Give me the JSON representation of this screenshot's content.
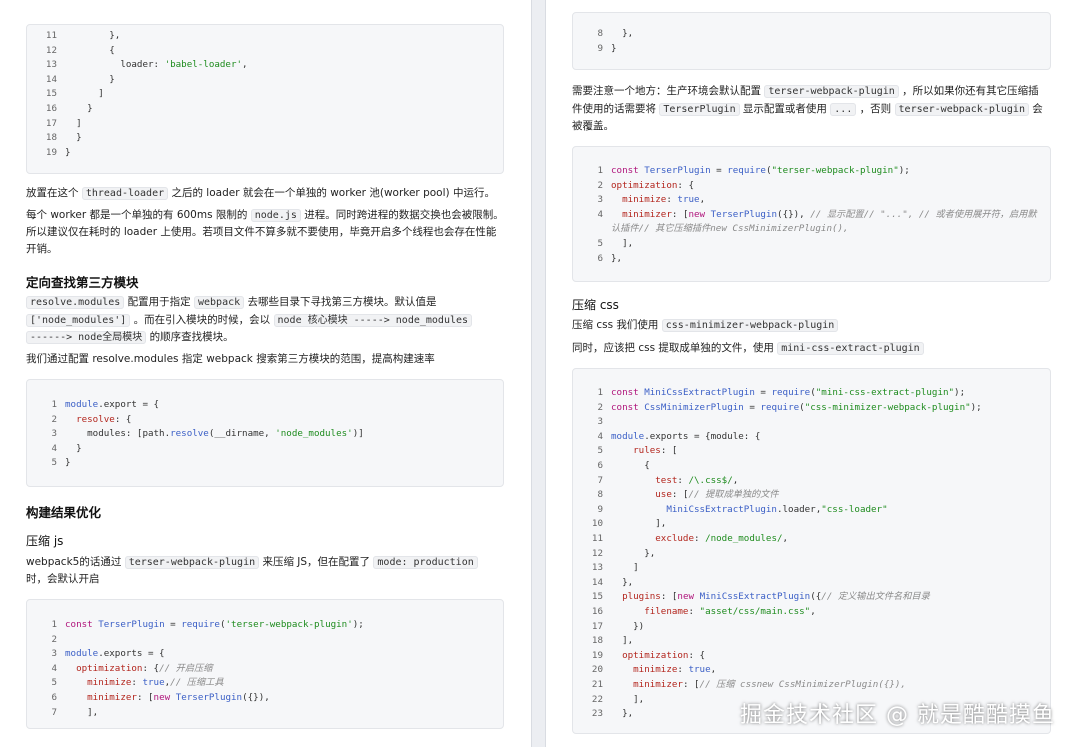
{
  "left": {
    "code1": [
      {
        "n": "11",
        "t": [
          [
            "p",
            "        },"
          ]
        ]
      },
      {
        "n": "12",
        "t": [
          [
            "p",
            "        {"
          ]
        ]
      },
      {
        "n": "13",
        "t": [
          [
            "p",
            "          loader: "
          ],
          [
            "s",
            "'babel-loader'"
          ],
          [
            "p",
            ","
          ]
        ]
      },
      {
        "n": "14",
        "t": [
          [
            "p",
            "        }"
          ]
        ]
      },
      {
        "n": "15",
        "t": [
          [
            "p",
            "      ]"
          ]
        ]
      },
      {
        "n": "16",
        "t": [
          [
            "p",
            "    }"
          ]
        ]
      },
      {
        "n": "17",
        "t": [
          [
            "p",
            "  ]"
          ]
        ]
      },
      {
        "n": "18",
        "t": [
          [
            "p",
            "  }"
          ]
        ]
      },
      {
        "n": "19",
        "t": [
          [
            "p",
            "}"
          ]
        ]
      }
    ],
    "para1": [
      [
        "t",
        "放置在这个 "
      ],
      [
        "code",
        "thread-loader"
      ],
      [
        "t",
        " 之后的 loader 就会在一个单独的 worker 池(worker pool) 中运行。"
      ]
    ],
    "para2_l1": [
      [
        "t",
        "每个 worker 都是一个单独的有 600ms 限制的 "
      ],
      [
        "code",
        "node.js"
      ],
      [
        "t",
        " 进程。同时跨进程的数据交换也会被限制。"
      ]
    ],
    "para2_l2": [
      [
        "t",
        "所以建议仅在耗时的 loader 上使用。若项目文件不算多就不要使用，毕竟开启多个线程也会存在性能"
      ]
    ],
    "para2_l3": [
      [
        "t",
        "开销。"
      ]
    ],
    "heading_resolve": "定向查找第三方模块",
    "para3_l1": [
      [
        "code",
        "resolve.modules"
      ],
      [
        "t",
        " 配置用于指定 "
      ],
      [
        "code",
        "webpack"
      ],
      [
        "t",
        " 去哪些目录下寻找第三方模块。默认值是"
      ]
    ],
    "para3_l2": [
      [
        "code",
        "['node_modules']"
      ],
      [
        "t",
        " 。而在引入模块的时候，会以 "
      ],
      [
        "code",
        "node 核心模块 -----> node_modules"
      ]
    ],
    "para3_l3": [
      [
        "code",
        "------> node全局模块"
      ],
      [
        "t",
        " 的顺序查找模块。"
      ]
    ],
    "para4": [
      [
        "t",
        "我们通过配置 resolve.modules 指定 webpack 搜索第三方模块的范围，提高构建速率"
      ]
    ],
    "code2": [
      {
        "n": "1",
        "t": [
          [
            "f",
            "module"
          ],
          [
            "p",
            ".export = {"
          ]
        ]
      },
      {
        "n": "2",
        "t": [
          [
            "p",
            "  "
          ],
          [
            "r",
            "resolve"
          ],
          [
            "p",
            ": {"
          ]
        ]
      },
      {
        "n": "3",
        "t": [
          [
            "p",
            "    modules: [path."
          ],
          [
            "f",
            "resolve"
          ],
          [
            "p",
            "(__dirname, "
          ],
          [
            "s",
            "'node_modules'"
          ],
          [
            "p",
            ")]"
          ]
        ]
      },
      {
        "n": "4",
        "t": [
          [
            "p",
            "  }"
          ]
        ]
      },
      {
        "n": "5",
        "t": [
          [
            "p",
            "}"
          ]
        ]
      }
    ],
    "heading_build": "构建结果优化",
    "heading_js": "压缩 js",
    "para5_l1": [
      [
        "t",
        "webpack5的话通过 "
      ],
      [
        "code",
        "terser-webpack-plugin"
      ],
      [
        "t",
        " 来压缩 JS，但在配置了 "
      ],
      [
        "code",
        "mode: production"
      ]
    ],
    "para5_l2": [
      [
        "t",
        "时，会默认开启"
      ]
    ],
    "code3": [
      {
        "n": "1",
        "t": [
          [
            "k",
            "const"
          ],
          [
            "p",
            " "
          ],
          [
            "f",
            "TerserPlugin"
          ],
          [
            "p",
            " = "
          ],
          [
            "f",
            "require"
          ],
          [
            "p",
            "("
          ],
          [
            "s",
            "'terser-webpack-plugin'"
          ],
          [
            "p",
            ");"
          ]
        ]
      },
      {
        "n": "2",
        "t": [
          [
            "p",
            ""
          ]
        ]
      },
      {
        "n": "3",
        "t": [
          [
            "f",
            "module"
          ],
          [
            "p",
            ".exports = {"
          ]
        ]
      },
      {
        "n": "4",
        "t": [
          [
            "p",
            "  "
          ],
          [
            "r",
            "optimization"
          ],
          [
            "p",
            ": {"
          ],
          [
            "c",
            "// 开启压缩"
          ]
        ]
      },
      {
        "n": "5",
        "t": [
          [
            "p",
            "    "
          ],
          [
            "r",
            "minimize"
          ],
          [
            "p",
            ": "
          ],
          [
            "f",
            "true"
          ],
          [
            "p",
            ","
          ],
          [
            "c",
            "// 压缩工具"
          ]
        ]
      },
      {
        "n": "6",
        "t": [
          [
            "p",
            "    "
          ],
          [
            "r",
            "minimizer"
          ],
          [
            "p",
            ": ["
          ],
          [
            "k",
            "new"
          ],
          [
            "p",
            " "
          ],
          [
            "f",
            "TerserPlugin"
          ],
          [
            "p",
            "({}),"
          ]
        ]
      },
      {
        "n": "7",
        "t": [
          [
            "p",
            "    ],"
          ]
        ]
      }
    ]
  },
  "right": {
    "code1": [
      {
        "n": "8",
        "t": [
          [
            "p",
            "  },"
          ]
        ]
      },
      {
        "n": "9",
        "t": [
          [
            "p",
            "}"
          ]
        ]
      }
    ],
    "para1_l1": [
      [
        "t",
        "需要注意一个地方：生产环境会默认配置 "
      ],
      [
        "code",
        "terser-webpack-plugin"
      ],
      [
        "t",
        " ，所以如果你还有其它压缩插"
      ]
    ],
    "para1_l2": [
      [
        "t",
        "件使用的话需要将 "
      ],
      [
        "code",
        "TerserPlugin"
      ],
      [
        "t",
        " 显示配置或者使用 "
      ],
      [
        "code",
        "..."
      ],
      [
        "t",
        " ，否则 "
      ],
      [
        "code",
        "terser-webpack-plugin"
      ],
      [
        "t",
        " 会"
      ]
    ],
    "para1_l3": [
      [
        "t",
        "被覆盖。"
      ]
    ],
    "code2": [
      {
        "n": "1",
        "t": [
          [
            "k",
            "const"
          ],
          [
            "p",
            " "
          ],
          [
            "f",
            "TerserPlugin"
          ],
          [
            "p",
            " = "
          ],
          [
            "f",
            "require"
          ],
          [
            "p",
            "("
          ],
          [
            "s",
            "\"terser-webpack-plugin\""
          ],
          [
            "p",
            ");"
          ]
        ]
      },
      {
        "n": "2",
        "t": [
          [
            "r",
            "optimization"
          ],
          [
            "p",
            ": {"
          ]
        ]
      },
      {
        "n": "3",
        "t": [
          [
            "p",
            "  "
          ],
          [
            "r",
            "minimize"
          ],
          [
            "p",
            ": "
          ],
          [
            "f",
            "true"
          ],
          [
            "p",
            ","
          ]
        ]
      },
      {
        "n": "4",
        "t": [
          [
            "p",
            "  "
          ],
          [
            "r",
            "minimizer"
          ],
          [
            "p",
            ": ["
          ],
          [
            "k",
            "new"
          ],
          [
            "p",
            " "
          ],
          [
            "f",
            "TerserPlugin"
          ],
          [
            "p",
            "({}), "
          ],
          [
            "c",
            "// 显示配置// \"...\", // 或者使用展开符，启用默"
          ]
        ]
      },
      {
        "n": "",
        "t": [
          [
            "c",
            "认插件// 其它压缩插件new CssMinimizerPlugin(),"
          ]
        ]
      },
      {
        "n": "5",
        "t": [
          [
            "p",
            "  ],"
          ]
        ]
      },
      {
        "n": "6",
        "t": [
          [
            "p",
            "},"
          ]
        ]
      }
    ],
    "heading_css": "压缩 css",
    "para2": [
      [
        "t",
        "压缩 css 我们使用 "
      ],
      [
        "code",
        "css-minimizer-webpack-plugin"
      ]
    ],
    "para3": [
      [
        "t",
        "同时，应该把 css 提取成单独的文件，使用 "
      ],
      [
        "code",
        "mini-css-extract-plugin"
      ]
    ],
    "code3": [
      {
        "n": "1",
        "t": [
          [
            "k",
            "const"
          ],
          [
            "p",
            " "
          ],
          [
            "f",
            "MiniCssExtractPlugin"
          ],
          [
            "p",
            " = "
          ],
          [
            "f",
            "require"
          ],
          [
            "p",
            "("
          ],
          [
            "s",
            "\"mini-css-extract-plugin\""
          ],
          [
            "p",
            ");"
          ]
        ]
      },
      {
        "n": "2",
        "t": [
          [
            "k",
            "const"
          ],
          [
            "p",
            " "
          ],
          [
            "f",
            "CssMinimizerPlugin"
          ],
          [
            "p",
            " = "
          ],
          [
            "f",
            "require"
          ],
          [
            "p",
            "("
          ],
          [
            "s",
            "\"css-minimizer-webpack-plugin\""
          ],
          [
            "p",
            ");"
          ]
        ]
      },
      {
        "n": "3",
        "t": [
          [
            "p",
            ""
          ]
        ]
      },
      {
        "n": "4",
        "t": [
          [
            "f",
            "module"
          ],
          [
            "p",
            ".exports = {module: {"
          ]
        ]
      },
      {
        "n": "5",
        "t": [
          [
            "p",
            "    "
          ],
          [
            "r",
            "rules"
          ],
          [
            "p",
            ": ["
          ]
        ]
      },
      {
        "n": "6",
        "t": [
          [
            "p",
            "      {"
          ]
        ]
      },
      {
        "n": "7",
        "t": [
          [
            "p",
            "        "
          ],
          [
            "r",
            "test"
          ],
          [
            "p",
            ": "
          ],
          [
            "s",
            "/\\.css$/"
          ],
          [
            "p",
            ","
          ]
        ]
      },
      {
        "n": "8",
        "t": [
          [
            "p",
            "        "
          ],
          [
            "r",
            "use"
          ],
          [
            "p",
            ": ["
          ],
          [
            "c",
            "// 提取成单独的文件"
          ]
        ]
      },
      {
        "n": "9",
        "t": [
          [
            "p",
            "          "
          ],
          [
            "f",
            "MiniCssExtractPlugin"
          ],
          [
            "p",
            ".loader,"
          ],
          [
            "s",
            "\"css-loader\""
          ]
        ]
      },
      {
        "n": "10",
        "t": [
          [
            "p",
            "        ],"
          ]
        ]
      },
      {
        "n": "11",
        "t": [
          [
            "p",
            "        "
          ],
          [
            "r",
            "exclude"
          ],
          [
            "p",
            ": "
          ],
          [
            "s",
            "/node_modules/"
          ],
          [
            "p",
            ","
          ]
        ]
      },
      {
        "n": "12",
        "t": [
          [
            "p",
            "      },"
          ]
        ]
      },
      {
        "n": "13",
        "t": [
          [
            "p",
            "    ]"
          ]
        ]
      },
      {
        "n": "14",
        "t": [
          [
            "p",
            "  },"
          ]
        ]
      },
      {
        "n": "15",
        "t": [
          [
            "p",
            "  "
          ],
          [
            "r",
            "plugins"
          ],
          [
            "p",
            ": ["
          ],
          [
            "k",
            "new"
          ],
          [
            "p",
            " "
          ],
          [
            "f",
            "MiniCssExtractPlugin"
          ],
          [
            "p",
            "({"
          ],
          [
            "c",
            "// 定义输出文件名和目录"
          ]
        ]
      },
      {
        "n": "16",
        "t": [
          [
            "p",
            "      "
          ],
          [
            "r",
            "filename"
          ],
          [
            "p",
            ": "
          ],
          [
            "s",
            "\"asset/css/main.css\""
          ],
          [
            "p",
            ","
          ]
        ]
      },
      {
        "n": "17",
        "t": [
          [
            "p",
            "    })"
          ]
        ]
      },
      {
        "n": "18",
        "t": [
          [
            "p",
            "  ],"
          ]
        ]
      },
      {
        "n": "19",
        "t": [
          [
            "p",
            "  "
          ],
          [
            "r",
            "optimization"
          ],
          [
            "p",
            ": {"
          ]
        ]
      },
      {
        "n": "20",
        "t": [
          [
            "p",
            "    "
          ],
          [
            "r",
            "minimize"
          ],
          [
            "p",
            ": "
          ],
          [
            "f",
            "true"
          ],
          [
            "p",
            ","
          ]
        ]
      },
      {
        "n": "21",
        "t": [
          [
            "p",
            "    "
          ],
          [
            "r",
            "minimizer"
          ],
          [
            "p",
            ": ["
          ],
          [
            "c",
            "// 压缩 cssnew CssMinimizerPlugin({}),"
          ]
        ]
      },
      {
        "n": "22",
        "t": [
          [
            "p",
            "    ],"
          ]
        ]
      },
      {
        "n": "23",
        "t": [
          [
            "p",
            "  },"
          ]
        ]
      }
    ]
  },
  "watermark": "掘金技术社区 @ 就是酷酷摸鱼"
}
